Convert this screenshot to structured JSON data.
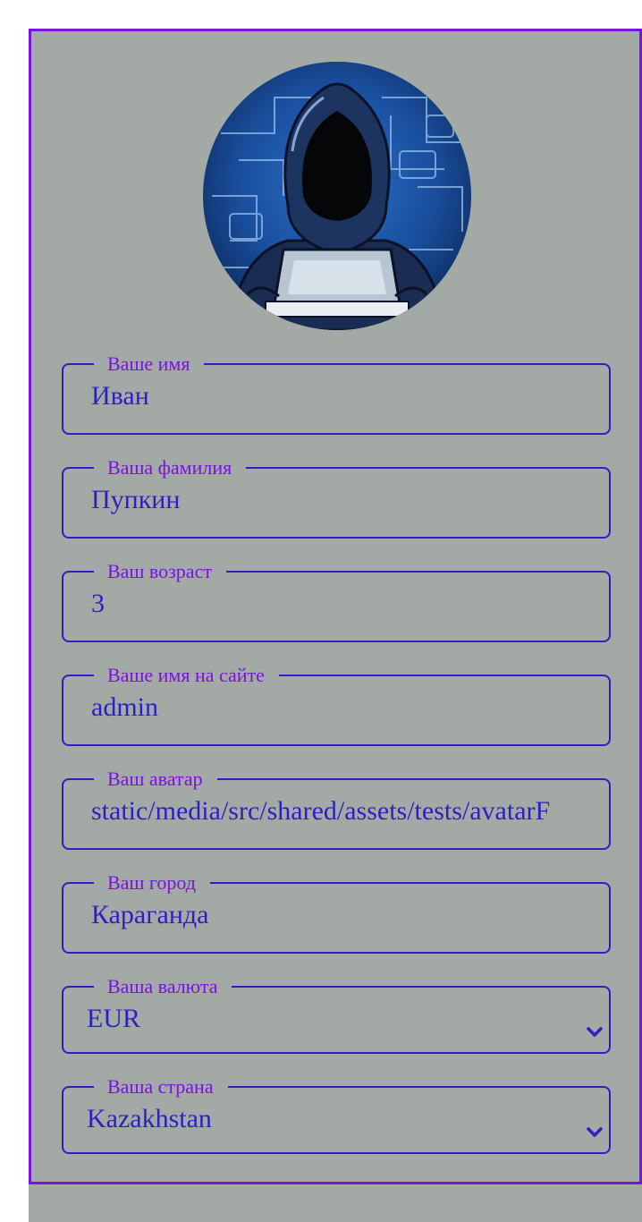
{
  "profile": {
    "avatar_alt": "Hooded hacker with laptop",
    "fields": [
      {
        "label": "Ваше имя",
        "value": "Иван"
      },
      {
        "label": "Ваша фамилия",
        "value": "Пупкин"
      },
      {
        "label": "Ваш возраст",
        "value": "3"
      },
      {
        "label": "Ваше имя на сайте",
        "value": "admin"
      },
      {
        "label": "Ваш аватар",
        "value": "static/media/src/shared/assets/tests/avatarF"
      },
      {
        "label": "Ваш город",
        "value": "Караганда"
      }
    ],
    "selects": [
      {
        "label": "Ваша валюта",
        "value": "EUR"
      },
      {
        "label": "Ваша страна",
        "value": "Kazakhstan"
      }
    ]
  },
  "colors": {
    "background": "#a3a9a5",
    "card_border": "#7a12e0",
    "input_border": "#2d1fc4",
    "label": "#7a12e0",
    "value": "#2d1fc4"
  },
  "icons": [
    "chevron-down-icon"
  ]
}
